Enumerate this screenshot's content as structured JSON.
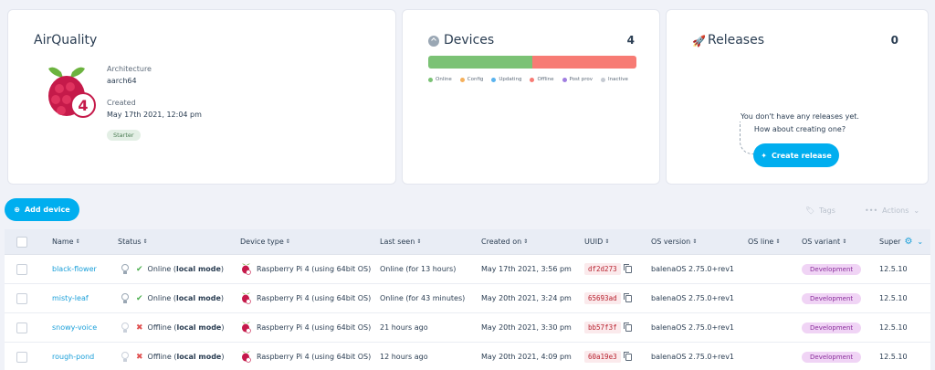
{
  "app": {
    "name": "AirQuality",
    "architecture_label": "Architecture",
    "architecture_value": "aarch64",
    "created_label": "Created",
    "created_value": "May 17th 2021, 12:04 pm",
    "plan_badge": "Starter",
    "logo_badge": "4"
  },
  "devices_card": {
    "title": "Devices",
    "count": "4",
    "progress": [
      {
        "status": "online",
        "fraction": 0.5,
        "color": "#7bc275"
      },
      {
        "status": "offline",
        "fraction": 0.5,
        "color": "#f77b74"
      }
    ],
    "legend": [
      {
        "label": "Online",
        "color": "#7bc275"
      },
      {
        "label": "Config",
        "color": "#f5b05c"
      },
      {
        "label": "Updating",
        "color": "#5ab3ee"
      },
      {
        "label": "Offline",
        "color": "#f77b74"
      },
      {
        "label": "Post prov",
        "color": "#a07ee0"
      },
      {
        "label": "Inactive",
        "color": "#c5cad2"
      }
    ]
  },
  "releases_card": {
    "title": "Releases",
    "count": "0",
    "empty_line1": "You don't have any releases yet.",
    "empty_line2": "How about creating one?",
    "create_label": "Create release"
  },
  "toolbar": {
    "add_device_label": "Add device",
    "tags_label": "Tags",
    "actions_label": "Actions"
  },
  "table": {
    "headers": {
      "name": "Name",
      "status": "Status",
      "device_type": "Device type",
      "last_seen": "Last seen",
      "created_on": "Created on",
      "uuid": "UUID",
      "os_version": "OS version",
      "os_line": "OS line",
      "os_variant": "OS variant",
      "supervisor": "Super"
    },
    "rows": [
      {
        "name": "black-flower",
        "online": true,
        "status": "Online",
        "mode": "local mode",
        "device_type": "Raspberry Pi 4 (using 64bit OS)",
        "last_seen": "Online (for 13 hours)",
        "created_on": "May 17th 2021, 3:56 pm",
        "uuid": "df2d273",
        "os_version": "balenaOS 2.75.0+rev1",
        "os_variant": "Development",
        "supervisor": "12.5.10"
      },
      {
        "name": "misty-leaf",
        "online": true,
        "status": "Online",
        "mode": "local mode",
        "device_type": "Raspberry Pi 4 (using 64bit OS)",
        "last_seen": "Online (for 43 minutes)",
        "created_on": "May 20th 2021, 3:24 pm",
        "uuid": "65693ad",
        "os_version": "balenaOS 2.75.0+rev1",
        "os_variant": "Development",
        "supervisor": "12.5.10"
      },
      {
        "name": "snowy-voice",
        "online": false,
        "status": "Offline",
        "mode": "local mode",
        "device_type": "Raspberry Pi 4 (using 64bit OS)",
        "last_seen": "21 hours ago",
        "created_on": "May 20th 2021, 3:30 pm",
        "uuid": "bb57f3f",
        "os_version": "balenaOS 2.75.0+rev1",
        "os_variant": "Development",
        "supervisor": "12.5.10"
      },
      {
        "name": "rough-pond",
        "online": false,
        "status": "Offline",
        "mode": "local mode",
        "device_type": "Raspberry Pi 4 (using 64bit OS)",
        "last_seen": "12 hours ago",
        "created_on": "May 20th 2021, 4:09 pm",
        "uuid": "60a19e3",
        "os_version": "balenaOS 2.75.0+rev1",
        "os_variant": "Development",
        "supervisor": "12.5.10"
      }
    ]
  }
}
